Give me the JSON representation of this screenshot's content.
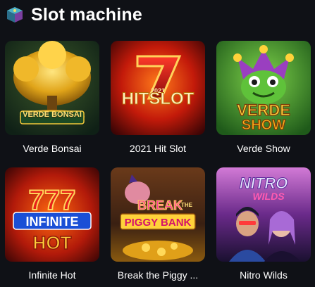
{
  "section": {
    "title": "Slot machine",
    "icon": "cube-icon"
  },
  "games": [
    {
      "name": "Verde Bonsai",
      "logo": [
        "VERDE",
        "BONSAI"
      ],
      "icon": "golden-tree-icon"
    },
    {
      "name": "2021 Hit Slot",
      "logo": [
        "7",
        "2021",
        "HITSLOT"
      ],
      "icon": "seven-icon"
    },
    {
      "name": "Verde Show",
      "logo": [
        "VERDE",
        "SHOW"
      ],
      "icon": "jester-frog-icon"
    },
    {
      "name": "Infinite Hot",
      "logo": [
        "777",
        "INFINITE",
        "HOT"
      ],
      "icon": "triple-seven-icon"
    },
    {
      "name": "Break the Piggy ...",
      "logo": [
        "BREAK",
        "THE",
        "PIGGY BANK"
      ],
      "icon": "piggy-bank-icon"
    },
    {
      "name": "Nitro Wilds",
      "logo": [
        "NITRO",
        "WILDS"
      ],
      "icon": "cyberpunk-duo-icon"
    }
  ]
}
